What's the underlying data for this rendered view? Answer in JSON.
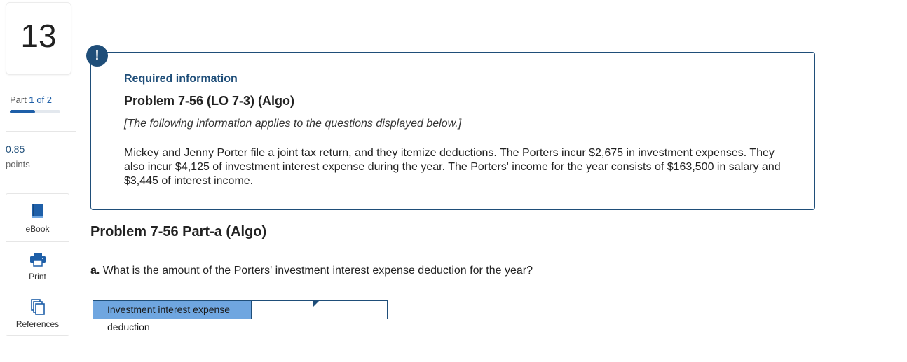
{
  "question": {
    "number": "13"
  },
  "part": {
    "label": "Part",
    "current": "1",
    "of": "of",
    "total": "2",
    "progress": 0.5
  },
  "points": {
    "value": "0.85",
    "label": "points"
  },
  "tools": [
    {
      "label": "eBook",
      "icon": "book-icon"
    },
    {
      "label": "Print",
      "icon": "printer-icon"
    },
    {
      "label": "References",
      "icon": "references-icon"
    }
  ],
  "info": {
    "alert_icon": "!",
    "required_title": "Required information",
    "problem_title": "Problem 7-56 (LO 7-3) (Algo)",
    "note": "[The following information applies to the questions displayed below.]",
    "paragraph": "Mickey and Jenny Porter file a joint tax return, and they itemize deductions. The Porters incur $2,675 in investment expenses. They also incur $4,125 of investment interest expense during the year. The Porters' income for the year consists of $163,500 in salary and $3,445 of interest income."
  },
  "part_heading": "Problem 7-56 Part-a (Algo)",
  "question_text": {
    "label": "a.",
    "text": "What is the amount of the Porters' investment interest expense deduction for the year?"
  },
  "answer": {
    "label": "Investment interest expense deduction",
    "value": ""
  },
  "colors": {
    "accent": "#1f4e79",
    "label_bg": "#6fa6e0"
  }
}
